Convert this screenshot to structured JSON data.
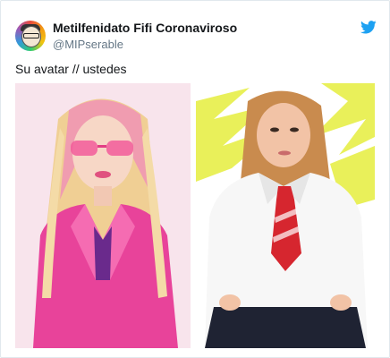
{
  "tweet": {
    "display_name": "Metilfenidato Fifi Coronaviroso",
    "handle": "@MIPserable",
    "text": "Su avatar // ustedes",
    "avatar_icon": "cartoon-avatar-icon",
    "platform_icon": "twitter-bird-icon",
    "accent_color": "#1da1f2"
  },
  "media": {
    "left_image": "pink-doll-image",
    "right_image": "schoolgirl-uniform-image",
    "colors": {
      "pink_jacket": "#e8439a",
      "hair_blonde": "#f2d59a",
      "right_bg_yellow": "#e9f05a",
      "tie_red": "#d6262f",
      "skirt_navy": "#1f2333"
    }
  }
}
